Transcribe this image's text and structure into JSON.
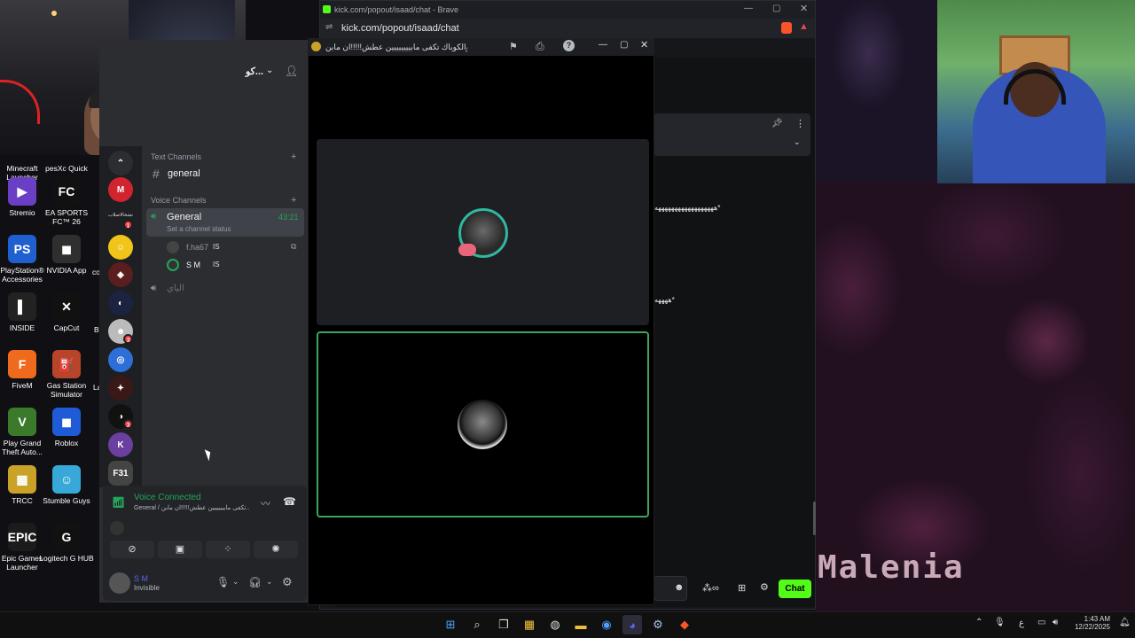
{
  "browser": {
    "title": "kick.com/popout/isaad/chat - Brave",
    "url": "kick.com/popout/isaad/chat",
    "chat_lines": [
      "ههههههههههههههههههه*",
      "ههههه*"
    ],
    "chat_button": "Chat",
    "infinity": "∞"
  },
  "call_window": {
    "title": "انا والكوباك تكفى مابيييييييين عطش!!!!!ان مابن"
  },
  "discord": {
    "server_name": "كو...",
    "text_channels_header": "Text Channels",
    "voice_channels_header": "Voice Channels",
    "text_channel": "general",
    "voice_channel": "General",
    "voice_timer": "43:21",
    "channel_status": "Set a channel status",
    "members": [
      {
        "name": "f.ha67",
        "tag": "IS"
      },
      {
        "name": "S M",
        "tag": "IS"
      }
    ],
    "other_voice_channel": "الياي",
    "guild_label": "نشخالاصلاب",
    "guild_badges": [
      "1",
      "3",
      "3"
    ],
    "guild_f31": "F31",
    "voice_connected": "Voice Connected",
    "voice_location": "General / تكفى مابيييييين عطش!!!!!ان مابن...",
    "user_name": "S M",
    "user_status": "Invisible"
  },
  "desktop_icons": [
    {
      "label": "Minecraft Launcher",
      "icon": "minecraft-icon",
      "color": "#5a8a3a"
    },
    {
      "label": "pesXc Quick",
      "icon": "pes-icon",
      "color": "#2a4a8a"
    },
    {
      "label": "Stremio",
      "icon": "stremio-icon",
      "color": "#6a3fc6"
    },
    {
      "label": "EA SPORTS FC™ 26",
      "icon": "ea-fc-icon",
      "color": "#111111"
    },
    {
      "label": "PlayStation® Accessories",
      "icon": "playstation-icon",
      "color": "#1f5fd0"
    },
    {
      "label": "NVIDIA App",
      "icon": "nvidia-icon",
      "color": "#2f2f2f"
    },
    {
      "label": "INSIDE",
      "icon": "inside-icon",
      "color": "#222222"
    },
    {
      "label": "CapCut",
      "icon": "capcut-icon",
      "color": "#111111"
    },
    {
      "label": "FiveM",
      "icon": "fivem-icon",
      "color": "#f06a1e"
    },
    {
      "label": "Gas Station Simulator",
      "icon": "gas-station-icon",
      "color": "#b8452a"
    },
    {
      "label": "Play Grand Theft Auto...",
      "icon": "gta-icon",
      "color": "#3a7a2a"
    },
    {
      "label": "Roblox",
      "icon": "roblox-icon",
      "color": "#1f5bd6"
    },
    {
      "label": "TRCC",
      "icon": "trcc-icon",
      "color": "#c9a227"
    },
    {
      "label": "Stumble Guys",
      "icon": "stumble-icon",
      "color": "#38a8d8"
    },
    {
      "label": "Epic Games Launcher",
      "icon": "epic-icon",
      "color": "#1b1b1b"
    },
    {
      "label": "Logitech G HUB",
      "icon": "logitech-icon",
      "color": "#111111"
    }
  ],
  "desktop_partial_labels": {
    "co": "co",
    "b": "B",
    "la": "La"
  },
  "wallpaper_text": "Malenia",
  "tray": {
    "time": "1:43 AM",
    "date": "12/22/2025",
    "lang": "ع"
  },
  "colors": {
    "discord_green": "#23a55a",
    "kick_green": "#53fc18",
    "discord_bg": "#2b2d31"
  }
}
